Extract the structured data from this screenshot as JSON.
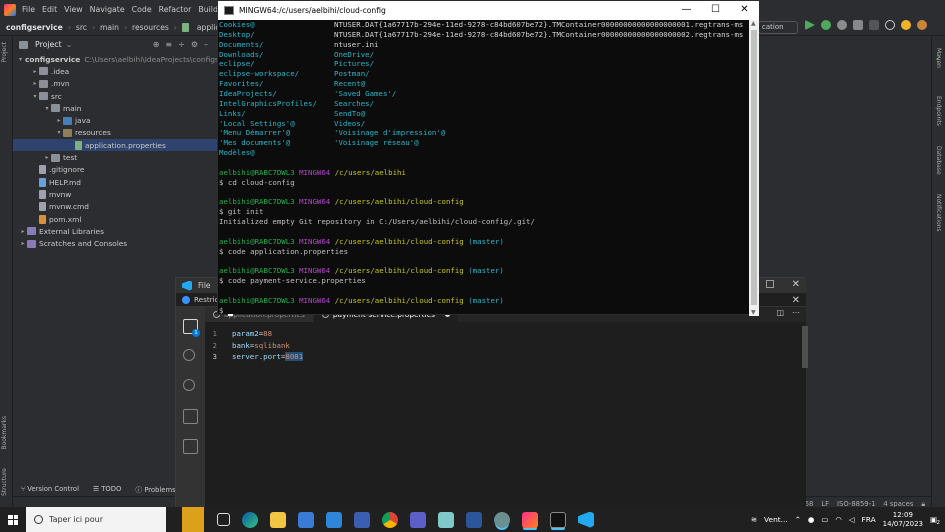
{
  "ij": {
    "menu": [
      "File",
      "Edit",
      "View",
      "Navigate",
      "Code",
      "Refactor",
      "Build"
    ],
    "nav": {
      "project": "configservice",
      "src": "src",
      "main": "main",
      "resources": "resources",
      "file": "application.properties"
    },
    "run_config": "cation",
    "project_header": "Project",
    "tree": [
      {
        "indent": 0,
        "arrow": "▾",
        "icon": "folder",
        "label": "configservice",
        "extra": "C:\\Users\\aelbihi\\IdeaProjects\\configse",
        "bold": true
      },
      {
        "indent": 1,
        "arrow": "▸",
        "icon": "folder",
        "label": ".idea"
      },
      {
        "indent": 1,
        "arrow": "▸",
        "icon": "folder",
        "label": ".mvn"
      },
      {
        "indent": 1,
        "arrow": "▾",
        "icon": "folder",
        "label": "src"
      },
      {
        "indent": 2,
        "arrow": "▾",
        "icon": "folder",
        "label": "main"
      },
      {
        "indent": 3,
        "arrow": "▸",
        "icon": "src",
        "label": "java"
      },
      {
        "indent": 3,
        "arrow": "▾",
        "icon": "res",
        "label": "resources"
      },
      {
        "indent": 4,
        "arrow": "",
        "icon": "props",
        "label": "application.properties",
        "sel": true
      },
      {
        "indent": 2,
        "arrow": "▸",
        "icon": "folder",
        "label": "test"
      },
      {
        "indent": 1,
        "arrow": "",
        "icon": "file",
        "label": ".gitignore"
      },
      {
        "indent": 1,
        "arrow": "",
        "icon": "md",
        "label": "HELP.md"
      },
      {
        "indent": 1,
        "arrow": "",
        "icon": "file",
        "label": "mvnw"
      },
      {
        "indent": 1,
        "arrow": "",
        "icon": "file",
        "label": "mvnw.cmd"
      },
      {
        "indent": 1,
        "arrow": "",
        "icon": "xml",
        "label": "pom.xml"
      },
      {
        "indent": 0,
        "arrow": "▸",
        "icon": "lib",
        "label": "External Libraries"
      },
      {
        "indent": 0,
        "arrow": "▸",
        "icon": "lib",
        "label": "Scratches and Consoles"
      }
    ],
    "left_strip": {
      "project": "Project",
      "bookmarks": "Bookmarks",
      "structure": "Structure"
    },
    "right_strip": {
      "notifications": "Notifications",
      "database": "Database",
      "endpoints": "Endpoints",
      "maven": "Maven"
    },
    "bottom_tools": [
      "Version Control",
      "TODO",
      "Problems"
    ],
    "status_right": [
      "2:68",
      "LF",
      "ISO-8859-1",
      "4 spaces"
    ]
  },
  "vscode": {
    "title": "File",
    "restricted": "Restric",
    "tabs": [
      {
        "label": "application.properties",
        "active": false,
        "dirty": false
      },
      {
        "label": "payment-service.properties",
        "active": true,
        "dirty": true
      }
    ],
    "lines": [
      {
        "n": "1",
        "key": "param2",
        "val": "88",
        "sel": false
      },
      {
        "n": "2",
        "key": "bank",
        "val": "sqlibank",
        "sel": false
      },
      {
        "n": "3",
        "key": "server.port",
        "val": "8081",
        "sel": true
      }
    ],
    "badge": "1"
  },
  "terminal": {
    "title": "MINGW64:/c/users/aelbihi/cloud-config",
    "listing": [
      [
        "Cookies@",
        "NTUSER.DAT{1a67717b-294e-11ed-9278-c84bd607be72}.TMContainer00000000000000000001.regtrans-ms"
      ],
      [
        "Desktop/",
        "NTUSER.DAT{1a67717b-294e-11ed-9278-c84bd607be72}.TMContainer00000000000000000002.regtrans-ms"
      ],
      [
        "Documents/",
        "ntuser.ini"
      ],
      [
        "Downloads/",
        "OneDrive/"
      ],
      [
        "eclipse/",
        "Pictures/"
      ],
      [
        "eclipse-workspace/",
        "Postman/"
      ],
      [
        "Favorites/",
        "Recent@"
      ],
      [
        "IdeaProjects/",
        "'Saved Games'/"
      ],
      [
        "IntelGraphicsProfiles/",
        "Searches/"
      ],
      [
        "Links/",
        "SendTo@"
      ],
      [
        "'Local Settings'@",
        "Videos/"
      ],
      [
        "'Menu Démarrer'@",
        "'Voisinage d'impression'@"
      ],
      [
        "'Mes documents'@",
        "'Voisinage réseau'@"
      ],
      [
        "Modèles@",
        ""
      ]
    ],
    "user": "aelbihi@RABC7DWL3",
    "shell": "MINGW64",
    "sessions": [
      {
        "path": "/c/users/aelbihi",
        "branch": "",
        "cmd": "$ cd cloud-config",
        "out": ""
      },
      {
        "path": "/c/users/aelbihi/cloud-config",
        "branch": "",
        "cmd": "$ git init",
        "out": "Initialized empty Git repository in C:/Users/aelbihi/cloud-config/.git/"
      },
      {
        "path": "/c/users/aelbihi/cloud-config",
        "branch": "(master)",
        "cmd": "$ code application.properties",
        "out": ""
      },
      {
        "path": "/c/users/aelbihi/cloud-config",
        "branch": "(master)",
        "cmd": "$ code payment-service.properties",
        "out": ""
      },
      {
        "path": "/c/users/aelbihi/cloud-config",
        "branch": "(master)",
        "cmd": "$ ",
        "out": ""
      }
    ]
  },
  "taskbar": {
    "search_placeholder": "Taper ici pour",
    "weather": "Vent...",
    "lang": "FRA",
    "time": "12:09",
    "date": "14/07/2023",
    "notif": "2"
  }
}
